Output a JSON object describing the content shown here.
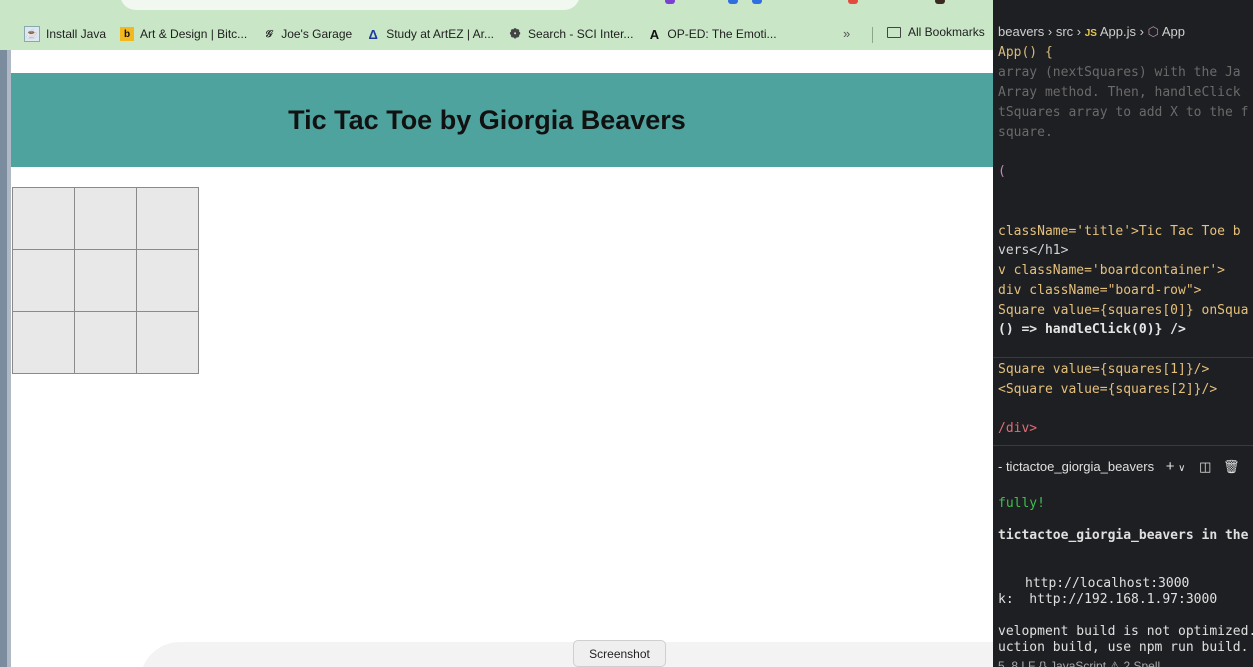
{
  "bookmarks": [
    {
      "label": "Install Java",
      "icon": "java-icon"
    },
    {
      "label": "Art & Design | Bitc...",
      "icon": "b-logo-icon"
    },
    {
      "label": "Joe's Garage",
      "icon": "garage-icon"
    },
    {
      "label": "Study at ArtEZ | Ar...",
      "icon": "artez-icon"
    },
    {
      "label": "Search - SCI Inter...",
      "icon": "sci-icon"
    },
    {
      "label": "OP-ED: The Emoti...",
      "icon": "a-logo-icon"
    }
  ],
  "bookmarks_more": "»",
  "all_bookmarks": "All Bookmarks",
  "page": {
    "title": "Tic Tac Toe by Giorgia Beavers",
    "title_band_color": "#4fa39e",
    "board": [
      [
        "",
        "",
        ""
      ],
      [
        "",
        "",
        ""
      ],
      [
        "",
        "",
        ""
      ]
    ]
  },
  "screenshot_tooltip": "Screenshot",
  "editor": {
    "breadcrumb": [
      "beavers",
      "src",
      "App.js",
      "App"
    ],
    "breadcrumb_js_badge": "JS",
    "code_lines": [
      "App() {",
      "array (nextSquares) with the Ja",
      "Array method. Then, handleClick",
      "tSquares array to add X to the f",
      "square.",
      "(",
      "className='title'>Tic Tac Toe b",
      "vers</h1>",
      "v className='boardcontainer'>",
      "div className=\"board-row\">",
      "Square value={squares[0]} onSqua",
      "() => handleClick(0)} />",
      "Square value={squares[1]}/>",
      "<Square value={squares[2]}/>",
      "/div>"
    ],
    "terminal_tab": "- tictactoe_giorgia_beavers",
    "terminal_lines": [
      "fully!",
      "tictactoe_giorgia_beavers in the b",
      "http://localhost:3000",
      "k:  http://192.168.1.97:3000",
      "velopment build is not optimized.",
      "uction build, use npm run build."
    ],
    "status": "5, 8    LF   {}  JavaScript    ⚠ 2 Spell"
  }
}
